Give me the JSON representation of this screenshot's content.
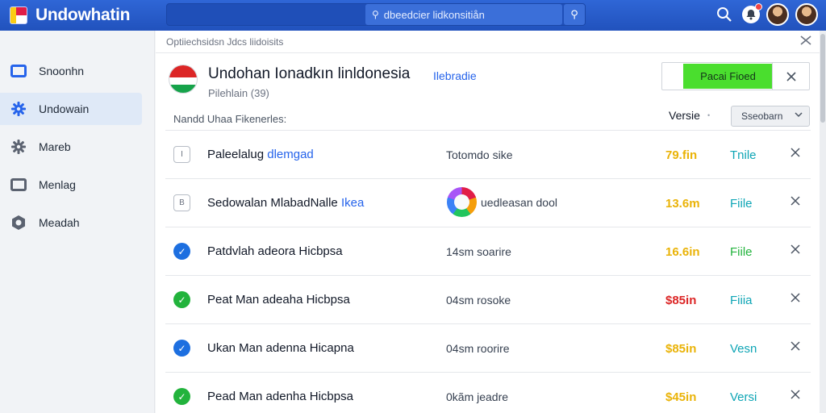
{
  "header": {
    "app_name": "Undowhatin",
    "search_value": "dbeedcier lidkonsitiån",
    "search_glyph": "⚲",
    "search_button_glyph": "⚲",
    "icons": [
      "search-icon",
      "notification-icon",
      "avatar",
      "avatar"
    ]
  },
  "sidebar": {
    "items": [
      {
        "label": "Snoonhn",
        "icon": "window-icon",
        "active": false
      },
      {
        "label": "Undowain",
        "icon": "gear-icon",
        "active": true
      },
      {
        "label": "Mareb",
        "icon": "settings-icon",
        "active": false
      },
      {
        "label": "Menlag",
        "icon": "window-icon",
        "active": false
      },
      {
        "label": "Meadah",
        "icon": "hexagon-icon",
        "active": false
      }
    ]
  },
  "main": {
    "breadcrumb": "Optiiechsidsn Jdcs liidoisits",
    "title": "Undohan Ionadkın linldonesia",
    "title_link": "Ilebradie",
    "subtitle": "Pilehlain (39)",
    "download_button": "Pacai Fioed",
    "list_label": "Nandd Uhaa Fikenerles:",
    "version_label": "Versie",
    "version_select": "Sseobarn",
    "rows": [
      {
        "status": "box",
        "status_glyph": "I",
        "name": "Paleelalug ",
        "name_highlight": "dlemgad",
        "size": "Totomdo sike",
        "badge": false,
        "price": "79.fin",
        "price_color": "#eab308",
        "type": "Tnile",
        "type_color": "#0ea5b5"
      },
      {
        "status": "box",
        "status_glyph": "B",
        "name": "Sedowalan MlabadNalle ",
        "name_highlight": "Ikea",
        "size": "uedleasan dool",
        "badge": true,
        "price": "13.6m",
        "price_color": "#eab308",
        "type": "Fiile",
        "type_color": "#0ea5b5"
      },
      {
        "status": "blue",
        "status_glyph": "✓",
        "name": "Patdvlah adeora Hicbpsa",
        "name_highlight": "",
        "size": "14sm soarire",
        "badge": false,
        "price": "16.6in",
        "price_color": "#eab308",
        "type": "Fiile",
        "type_color": "#22b33c"
      },
      {
        "status": "green",
        "status_glyph": "✓",
        "name": "Peat Man adeaha Hicbpsa",
        "name_highlight": "",
        "size": "04sm rosoke",
        "badge": false,
        "price": "$85in",
        "price_color": "#dc2626",
        "type": "Fiiia",
        "type_color": "#0ea5b5"
      },
      {
        "status": "blue",
        "status_glyph": "✓",
        "name": "Ukan Man adenna Hicapna",
        "name_highlight": "",
        "size": "04sm roorire",
        "badge": false,
        "price": "$85in",
        "price_color": "#eab308",
        "type": "Vesn",
        "type_color": "#0ea5b5"
      },
      {
        "status": "green",
        "status_glyph": "✓",
        "name": "Pead Man adenha Hicbpsa",
        "name_highlight": "",
        "size": "0kãm jeadre",
        "badge": false,
        "price": "$45in",
        "price_color": "#eab308",
        "type": "Versi",
        "type_color": "#0ea5b5"
      }
    ]
  },
  "colors": {
    "topbar": "#2457c5",
    "accent": "#2563eb",
    "download": "#4ade2e"
  }
}
